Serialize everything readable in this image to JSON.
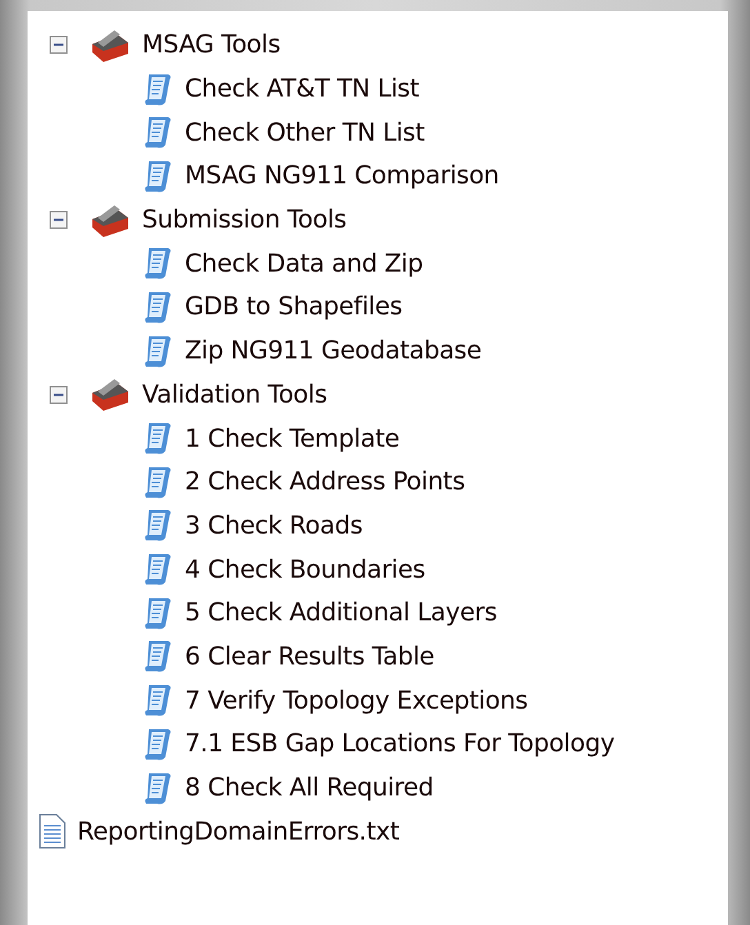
{
  "tree": [
    {
      "label": "MSAG Tools",
      "kind": "toolbox",
      "expanded": true,
      "children": [
        {
          "label": "Check AT&T TN List",
          "kind": "script"
        },
        {
          "label": "Check Other TN List",
          "kind": "script"
        },
        {
          "label": "MSAG NG911 Comparison",
          "kind": "script"
        }
      ]
    },
    {
      "label": "Submission Tools",
      "kind": "toolbox",
      "expanded": true,
      "children": [
        {
          "label": "Check Data and Zip",
          "kind": "script"
        },
        {
          "label": "GDB to Shapefiles",
          "kind": "script"
        },
        {
          "label": "Zip NG911 Geodatabase",
          "kind": "script"
        }
      ]
    },
    {
      "label": "Validation Tools",
      "kind": "toolbox",
      "expanded": true,
      "children": [
        {
          "label": "1 Check Template",
          "kind": "script"
        },
        {
          "label": "2 Check Address Points",
          "kind": "script"
        },
        {
          "label": "3 Check Roads",
          "kind": "script"
        },
        {
          "label": "4 Check Boundaries",
          "kind": "script"
        },
        {
          "label": "5 Check Additional Layers",
          "kind": "script"
        },
        {
          "label": "6 Clear Results Table",
          "kind": "script"
        },
        {
          "label": "7 Verify Topology Exceptions",
          "kind": "script"
        },
        {
          "label": "7.1 ESB Gap Locations For Topology",
          "kind": "script"
        },
        {
          "label": "8 Check All Required",
          "kind": "script"
        }
      ]
    },
    {
      "label": "ReportingDomainErrors.txt",
      "kind": "file"
    }
  ]
}
